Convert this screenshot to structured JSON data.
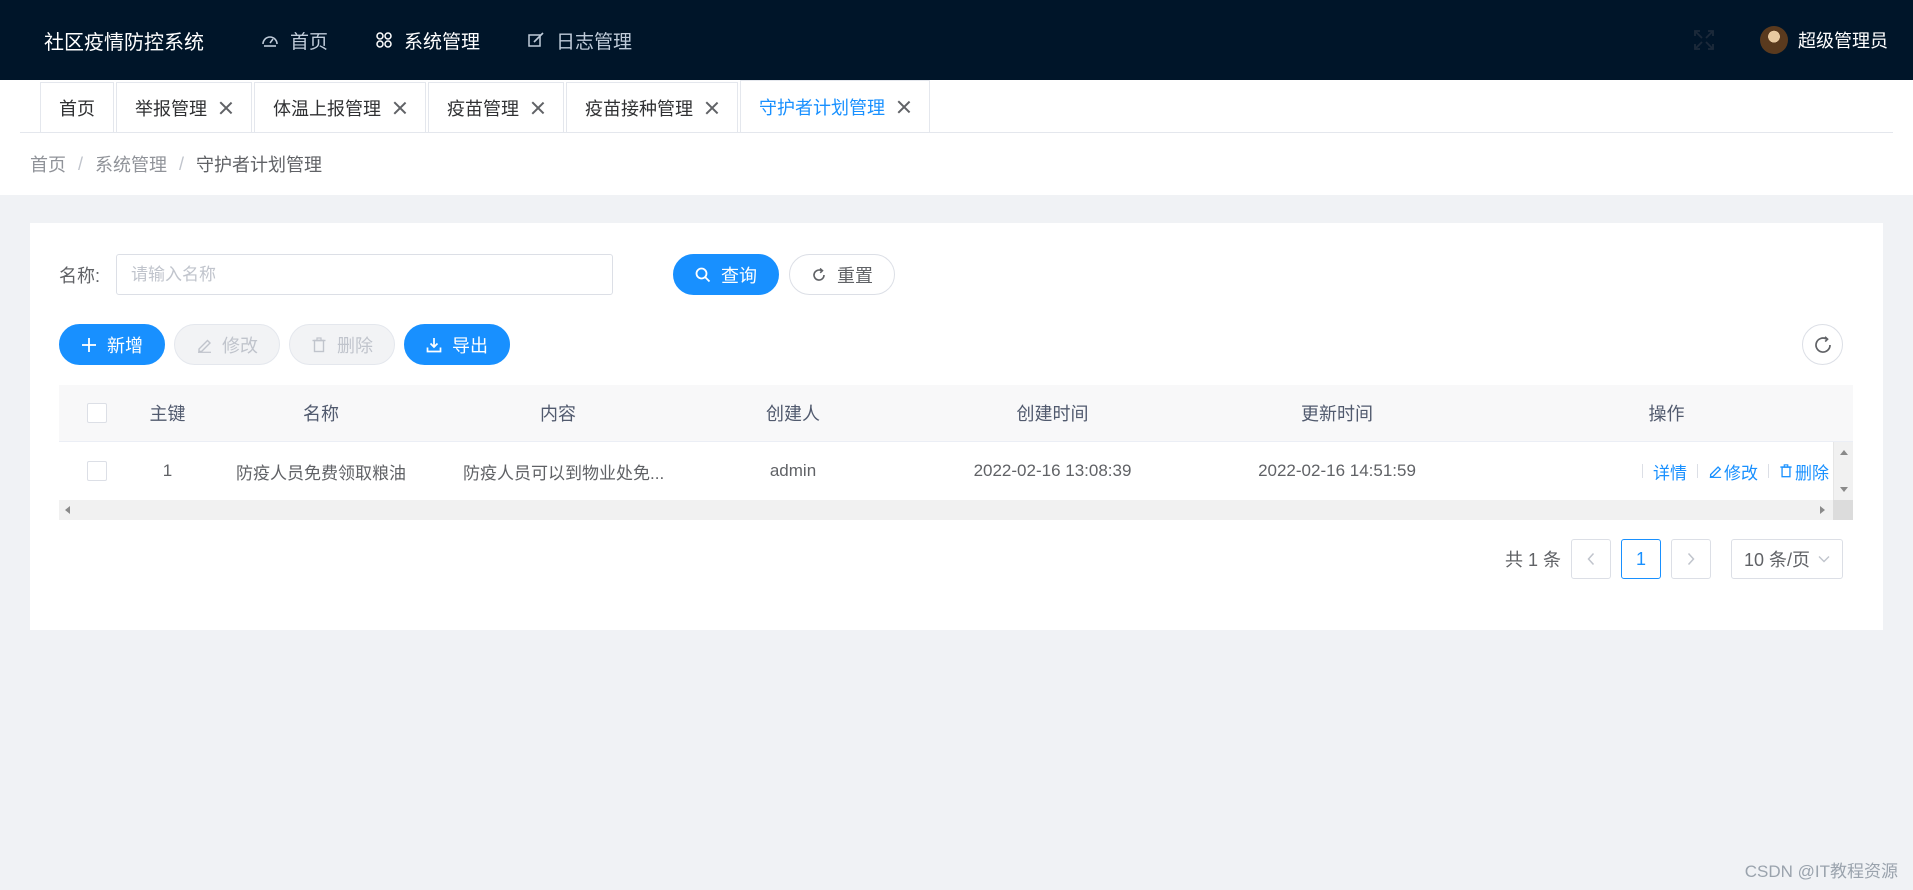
{
  "app": {
    "title": "社区疫情防控系统"
  },
  "nav": {
    "items": [
      {
        "label": "首页",
        "icon": "dashboard-icon"
      },
      {
        "label": "系统管理",
        "icon": "grid-icon"
      },
      {
        "label": "日志管理",
        "icon": "edit-icon"
      }
    ]
  },
  "user": {
    "name": "超级管理员"
  },
  "tabs": [
    {
      "label": "首页"
    },
    {
      "label": "举报管理"
    },
    {
      "label": "体温上报管理"
    },
    {
      "label": "疫苗管理"
    },
    {
      "label": "疫苗接种管理"
    },
    {
      "label": "守护者计划管理"
    }
  ],
  "breadcrumb": {
    "items": [
      "首页",
      "系统管理",
      "守护者计划管理"
    ]
  },
  "search": {
    "label": "名称:",
    "placeholder": "请输入名称",
    "value": ""
  },
  "buttons": {
    "query": "查询",
    "reset": "重置",
    "add": "新增",
    "edit": "修改",
    "delete": "删除",
    "export": "导出"
  },
  "table": {
    "headers": {
      "id": "主键",
      "name": "名称",
      "content": "内容",
      "creator": "创建人",
      "create_time": "创建时间",
      "update_time": "更新时间",
      "ops": "操作"
    },
    "rows": [
      {
        "id": "1",
        "name": "防疫人员免费领取粮油",
        "content": "防疫人员可以到物业处免...",
        "creator": "admin",
        "create_time": "2022-02-16 13:08:39",
        "update_time": "2022-02-16 14:51:59",
        "ops": {
          "detail": "详情",
          "edit": "修改",
          "delete": "删除"
        }
      }
    ]
  },
  "pagination": {
    "total": "共 1 条",
    "current": "1",
    "page_size": "10 条/页"
  },
  "watermark": "CSDN @IT教程资源",
  "colors": {
    "navbar": "#001529",
    "primary": "#1890ff",
    "background": "#f0f2f5"
  }
}
